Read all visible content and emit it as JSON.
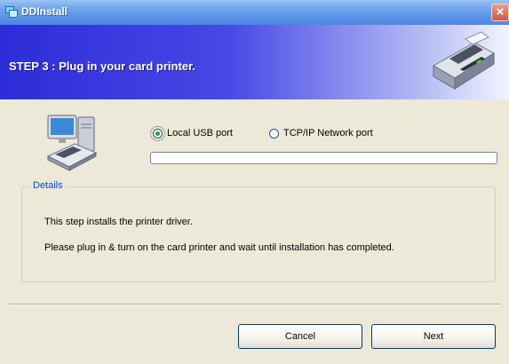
{
  "window": {
    "title": "DDInstall",
    "title_icon": "app-icon",
    "close_label": "×"
  },
  "header": {
    "step_title": "STEP 3 :  Plug in your card printer.",
    "image_icon": "card-printer-icon"
  },
  "connection": {
    "options": [
      {
        "label": "Local USB port",
        "selected": true
      },
      {
        "label": "TCP/IP Network port",
        "selected": false
      }
    ],
    "progress": 0
  },
  "details": {
    "legend": "Details",
    "lines": [
      "This step installs the printer driver.",
      "Please plug in & turn on the card printer and wait until installation has completed."
    ]
  },
  "buttons": {
    "cancel_label": "Cancel",
    "next_label": "Next"
  },
  "colors": {
    "header_start": "#2d2dd9",
    "titlebar": "#5b92e8",
    "window_bg": "#ece9d8",
    "legend_text": "#0046d5"
  }
}
